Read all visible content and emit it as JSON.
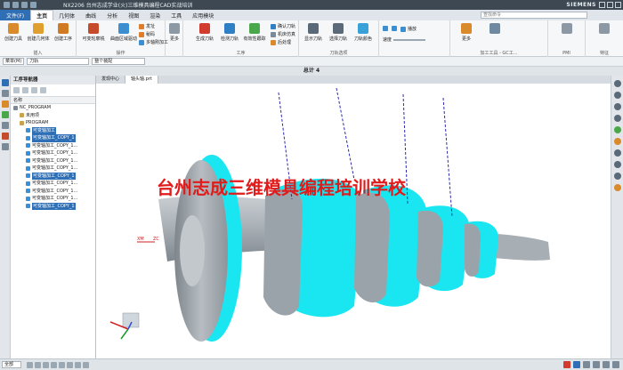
{
  "window": {
    "title": "NX2206 台州志成学业(火)三维模具编程CAD实战培训",
    "brand": "SIEMENS"
  },
  "ribbon_tabs": [
    "文件(F)",
    "主页",
    "几何体",
    "曲线",
    "分析",
    "视图",
    "渲染",
    "工具",
    "应用模块"
  ],
  "command_search_placeholder": "查找命令",
  "ribbon": {
    "insert": {
      "label": "插入",
      "buttons": [
        "创建刀具",
        "创建几何体",
        "创建工序"
      ]
    },
    "ops": {
      "label": "操作",
      "buttons": [
        "可变轮廓铣",
        "曲面区域驱动"
      ],
      "small": [
        "发址",
        "秘码",
        "多轴刚加工"
      ]
    },
    "shop": {
      "label": "工序",
      "buttons": [
        "生成刀轨",
        "检测刀轨",
        "有效性跟踪"
      ],
      "small": [
        "确认刀轨",
        "机床仿真",
        "后处理"
      ]
    },
    "display": {
      "label": "显示",
      "buttons": [
        "显示刀轨",
        "选择刀轨",
        "刀轨颜色"
      ]
    },
    "more": "更多",
    "filter": "刀轨选项",
    "speed_label": "速度",
    "play": "播放",
    "gc_group": "加工工具 - GC工...",
    "pmi": "PMI",
    "feature": "特征"
  },
  "selection_bar": {
    "menu": "菜单(M)",
    "filter": "刀轨",
    "assembly": "整个装配"
  },
  "view_title": "总计 4",
  "navigator": {
    "title": "工序导航器",
    "column": "名称",
    "items": [
      {
        "label": "NC_PROGRAM",
        "level": 0,
        "icon_color": "#7a8a99",
        "selected": false
      },
      {
        "label": "未用项",
        "level": 1,
        "icon_color": "#c9a24d",
        "selected": false
      },
      {
        "label": "PROGRAM",
        "level": 1,
        "icon_color": "#c9a24d",
        "selected": false
      },
      {
        "label": "可变轴加工",
        "level": 2,
        "icon_color": "#3a8fd9",
        "selected": true
      },
      {
        "label": "可变轴加工_COPY_1",
        "level": 2,
        "icon_color": "#3a8fd9",
        "selected": true
      },
      {
        "label": "可变轴加工_COPY_1...",
        "level": 2,
        "icon_color": "#3a8fd9",
        "selected": false
      },
      {
        "label": "可变轴加工_COPY_1...",
        "level": 2,
        "icon_color": "#3a8fd9",
        "selected": false
      },
      {
        "label": "可变轴加工_COPY_1...",
        "level": 2,
        "icon_color": "#3a8fd9",
        "selected": false
      },
      {
        "label": "可变轴加工_COPY_1...",
        "level": 2,
        "icon_color": "#3a8fd9",
        "selected": false
      },
      {
        "label": "可变轴加工_COPY_1",
        "level": 2,
        "icon_color": "#3a8fd9",
        "selected": true
      },
      {
        "label": "可变轴加工_COPY_1...",
        "level": 2,
        "icon_color": "#3a8fd9",
        "selected": false
      },
      {
        "label": "可变轴加工_COPY_1...",
        "level": 2,
        "icon_color": "#3a8fd9",
        "selected": false
      },
      {
        "label": "可变轴加工_COPY_1...",
        "level": 2,
        "icon_color": "#3a8fd9",
        "selected": false
      },
      {
        "label": "可变轴加工_COPY_1",
        "level": 2,
        "icon_color": "#3a8fd9",
        "selected": true
      }
    ]
  },
  "doc_tabs": [
    "发现中心",
    "轴头轴.prt"
  ],
  "watermark": "台州志成三维模具编程培训学校",
  "axis_labels": {
    "xm": "XM",
    "zc": "ZC"
  },
  "status_bar": {
    "filter": "全部"
  },
  "colors": {
    "accent": "#2f6fb5",
    "part_gray": "#9aa3aa",
    "toolpath_cyan": "#19e6f0",
    "toolaxis_blue": "#2a2ab0",
    "watermark_red": "#e01b1b"
  }
}
